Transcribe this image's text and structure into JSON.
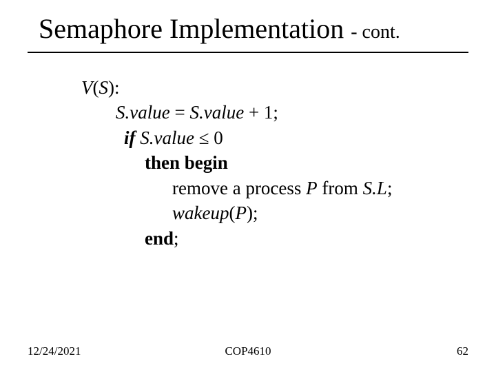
{
  "title": {
    "main": "Semaphore Implementation",
    "suffix": "- cont."
  },
  "code": {
    "l1_vs": "V",
    "l1_paren_open": "(",
    "l1_s": "S",
    "l1_paren_close": "):",
    "l2_lhs": "S.value",
    "l2_eq": " = ",
    "l2_rhs": "S.value",
    "l2_plus": " + 1;",
    "l3_if": "if ",
    "l3_sv": "S.value",
    "l3_le": " ≤ 0",
    "l4_then": "then begin",
    "l5_pre": "remove a process ",
    "l5_p": "P",
    "l5_mid": " from ",
    "l5_sl": "S.L",
    "l5_semi": ";",
    "l6_wake": "wakeup",
    "l6_paren_open": "(",
    "l6_p": "P",
    "l6_paren_close": ");",
    "l7_end": "end",
    "l7_semi": ";"
  },
  "footer": {
    "date": "12/24/2021",
    "course": "COP4610",
    "page": "62"
  }
}
